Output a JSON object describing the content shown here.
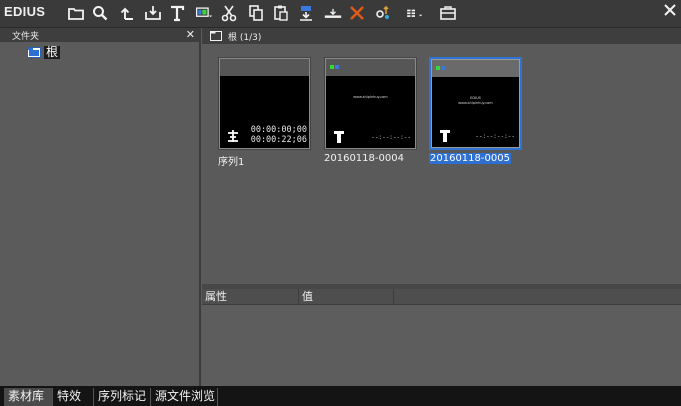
{
  "app": {
    "brand": "EDIUS"
  },
  "toolbar": {
    "icons": [
      "folder-icon",
      "search-icon",
      "up-arrow-icon",
      "import-icon",
      "title-icon",
      "monitor-icon",
      "cut-icon",
      "copy-icon",
      "paste-icon",
      "add-to-timeline-icon",
      "insert-icon",
      "delete-icon",
      "properties-icon",
      "view-mode-icon",
      "bin-settings-icon"
    ]
  },
  "folder_panel": {
    "title": "文件夹",
    "close_glyph": "✕",
    "tree": [
      {
        "label": "根",
        "icon": "folder-icon"
      }
    ]
  },
  "bin": {
    "path_label": "根 (1/3)",
    "clips": [
      {
        "name": "序列1",
        "timecode_in": "00:00:00;00",
        "timecode_dur": "00:00:22;06",
        "selected": false,
        "type_icon": "sequence-icon"
      },
      {
        "name": "20160118-0004",
        "dashes": "--:--:--:--",
        "caption": "www.shipinhuy.com",
        "selected": false,
        "type_icon": "title-clip-icon"
      },
      {
        "name": "20160118-0005",
        "dashes": "--:--:--:--",
        "caption_line1": "EDIUS",
        "caption_line2": "www.shipinhuy.com",
        "selected": true,
        "type_icon": "title-clip-icon"
      }
    ]
  },
  "properties": {
    "columns": [
      "属性",
      "值",
      ""
    ]
  },
  "bottom_tabs": [
    {
      "label": "素材库",
      "active": true
    },
    {
      "label": "特效",
      "active": false
    },
    {
      "label": "序列标记",
      "active": false
    },
    {
      "label": "源文件浏览",
      "active": false
    }
  ],
  "colors": {
    "selection": "#2e74d6",
    "panel_bg": "#5c5c5c",
    "header_bg": "#3e3e3e"
  }
}
